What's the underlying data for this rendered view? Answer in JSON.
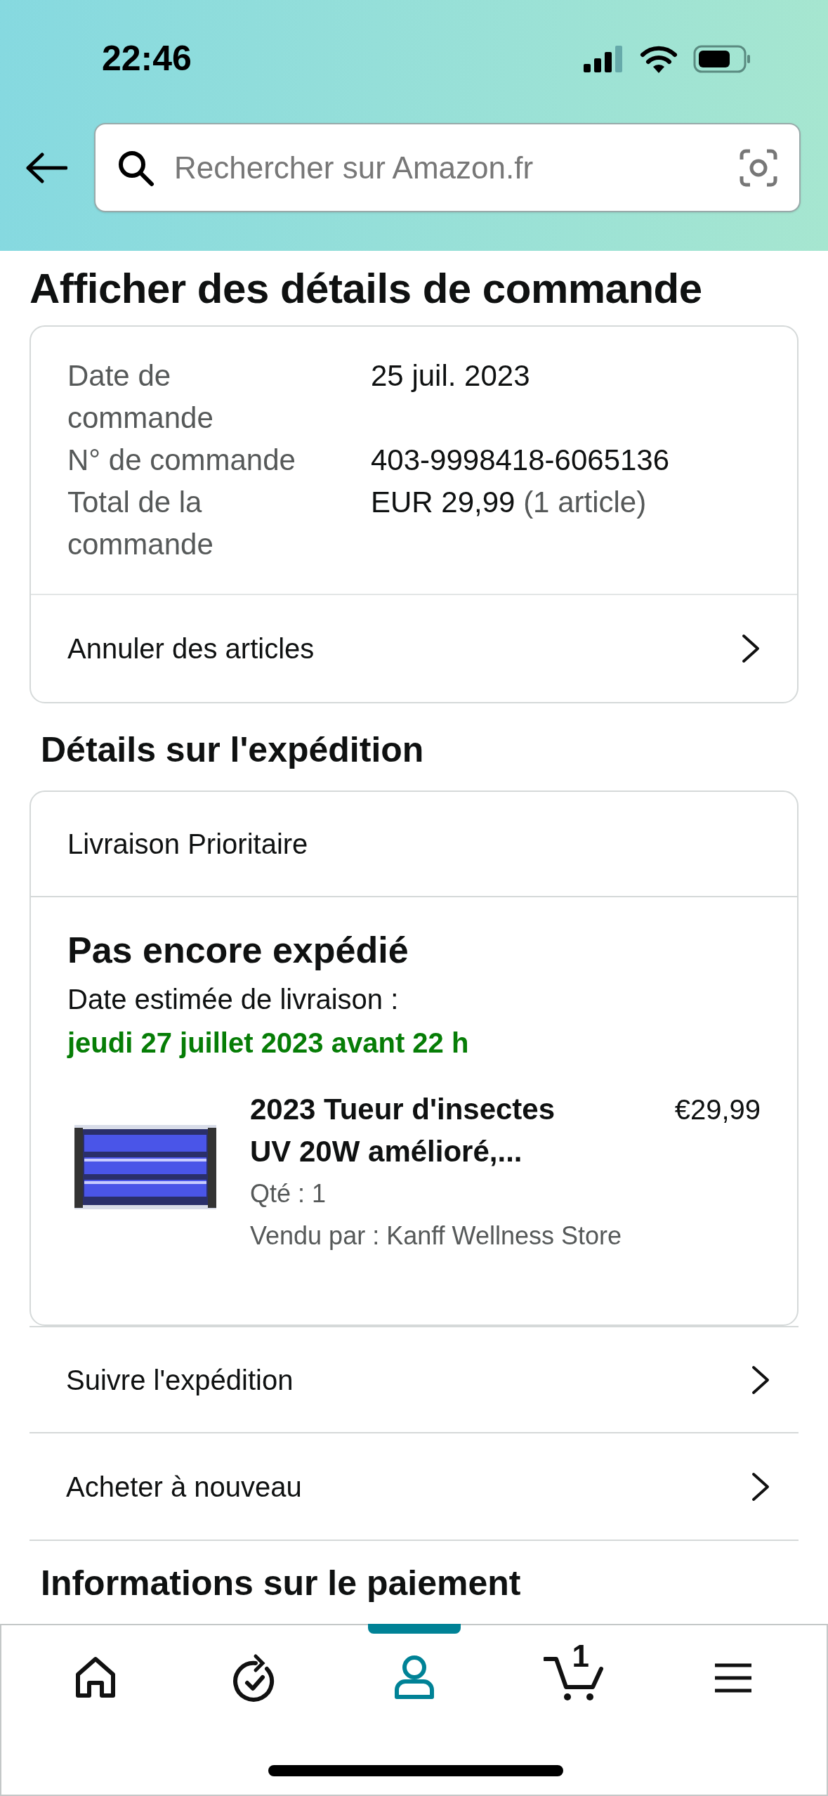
{
  "status_bar": {
    "time": "22:46"
  },
  "search": {
    "placeholder": "Rechercher sur Amazon.fr"
  },
  "title": "Afficher des détails de commande",
  "order_summary": {
    "rows": [
      {
        "label": "Date de commande",
        "value": "25 juil. 2023"
      },
      {
        "label": "N° de commande",
        "value": "403-9998418-6065136"
      },
      {
        "label": "Total de la commande",
        "value": "EUR 29,99",
        "note": "(1 article)"
      }
    ],
    "action": "Annuler des articles"
  },
  "shipping": {
    "heading": "Détails sur l'expédition",
    "method": "Livraison Prioritaire",
    "status": "Pas encore expédié",
    "estimate_label": "Date estimée de livraison :",
    "estimate": "jeudi 27 juillet 2023 avant 22 h",
    "item": {
      "kind": "picture",
      "title": "2023 Tueur d'insectes UV 20W amélioré,...",
      "price": "€29,99",
      "quantity": "Qté : 1",
      "seller": "Vendu par : Kanff Wellness Store"
    }
  },
  "actions": [
    "Suivre l'expédition",
    "Acheter à nouveau"
  ],
  "next_heading": "Informations sur le paiement",
  "nav": [
    {
      "kind": "home",
      "selected": false
    },
    {
      "kind": "reorder",
      "selected": false
    },
    {
      "kind": "account",
      "selected": true
    },
    {
      "kind": "cart",
      "selected": false,
      "badge": "1"
    },
    {
      "kind": "menu",
      "selected": false
    }
  ]
}
